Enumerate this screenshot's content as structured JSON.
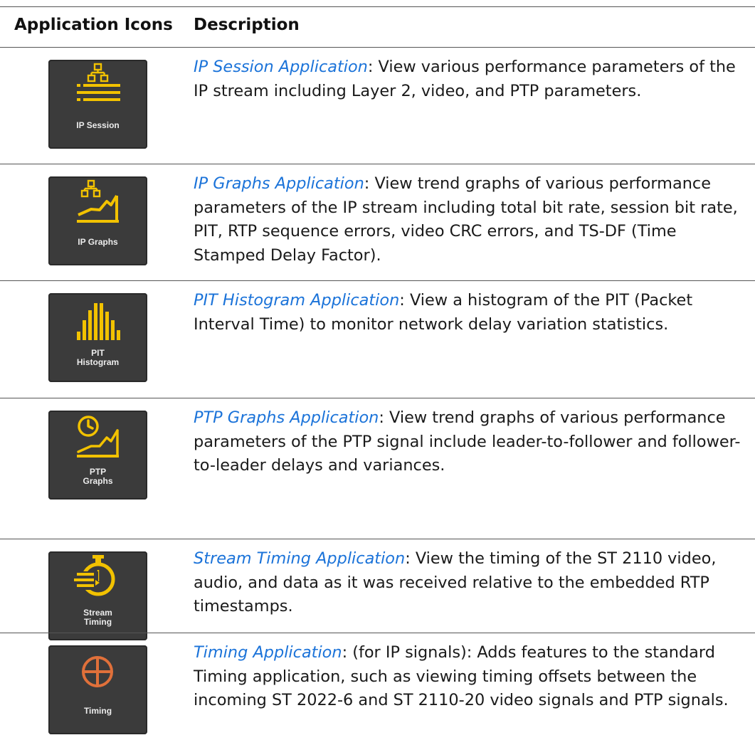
{
  "table": {
    "headers": {
      "icons": "Application Icons",
      "description": "Description"
    },
    "rows": [
      {
        "icon_name": "ip-session-icon",
        "icon_label": "IP Session",
        "link": "IP Session Application",
        "text": ": View various performance parameters of the IP stream including Layer 2, video, and PTP parameters."
      },
      {
        "icon_name": "ip-graphs-icon",
        "icon_label": "IP Graphs",
        "link": "IP Graphs Application",
        "text": ": View trend graphs of various performance parameters of the IP stream including total bit rate, session bit rate, PIT, RTP sequence errors, video CRC errors, and TS-DF (Time Stamped Delay Factor)."
      },
      {
        "icon_name": "pit-histogram-icon",
        "icon_label_1": "PIT",
        "icon_label_2": "Histogram",
        "link": "PIT Histogram Application",
        "text": ": View a histogram of the PIT (Packet Interval Time) to monitor network delay variation statistics."
      },
      {
        "icon_name": "ptp-graphs-icon",
        "icon_label_1": "PTP",
        "icon_label_2": "Graphs",
        "link": "PTP Graphs Application",
        "text": ": View trend graphs of various performance parameters of the PTP signal include leader-to-follower and follower-to-leader delays and variances."
      },
      {
        "icon_name": "stream-timing-icon",
        "icon_label_1": "Stream",
        "icon_label_2": "Timing",
        "link": "Stream Timing Application",
        "text": ": View the timing of the ST 2110 video, audio, and data as it was received relative to the embedded RTP timestamps."
      },
      {
        "icon_name": "timing-icon",
        "icon_label": "Timing",
        "link": "Timing Application",
        "text": ": (for IP signals): Adds features to the standard Timing application, such as viewing timing offsets between the incoming ST 2022-6 and ST 2110-20 video signals and PTP signals."
      }
    ]
  },
  "colors": {
    "link": "#1b73d9",
    "icon_yellow": "#f2c200",
    "icon_orange": "#e0703a",
    "icon_bg": "#3b3b3b"
  }
}
